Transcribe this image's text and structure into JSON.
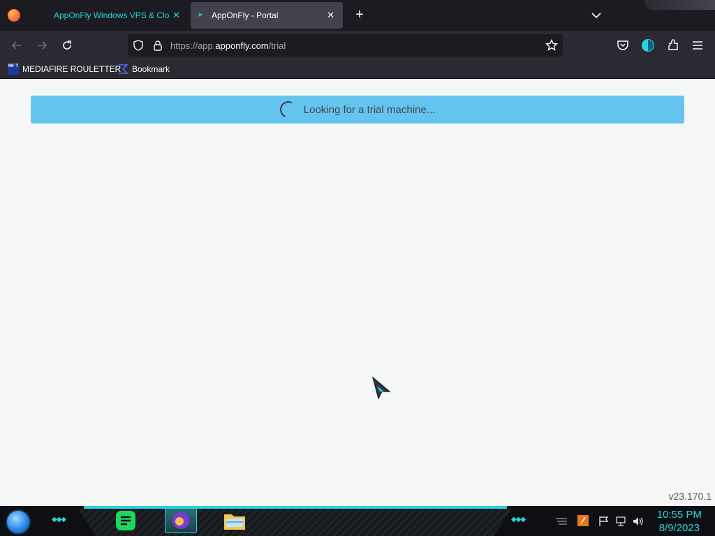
{
  "browser": {
    "tabs": [
      {
        "title": "AppOnFly Windows VPS & Cloud",
        "active": false
      },
      {
        "title": "AppOnFly - Portal",
        "active": true
      }
    ],
    "url": {
      "prefix": "https://app.",
      "domain": "apponfly.com",
      "path": "/trial"
    },
    "bookmarks": [
      {
        "label": "MEDIAFIRE ROULETTER",
        "icon": "mft-icon",
        "icon_text": "MF T"
      },
      {
        "label": "Bookmark",
        "icon": "sigma-icon"
      }
    ]
  },
  "page": {
    "status_message": "Looking for a trial machine...",
    "version": "v23.170.1"
  },
  "taskbar": {
    "time": "10:55 PM",
    "date": "8/9/2023"
  },
  "colors": {
    "alert_bg": "#65c4ee",
    "accent": "#2ad4d4",
    "page_bg": "#f5f6f6"
  }
}
